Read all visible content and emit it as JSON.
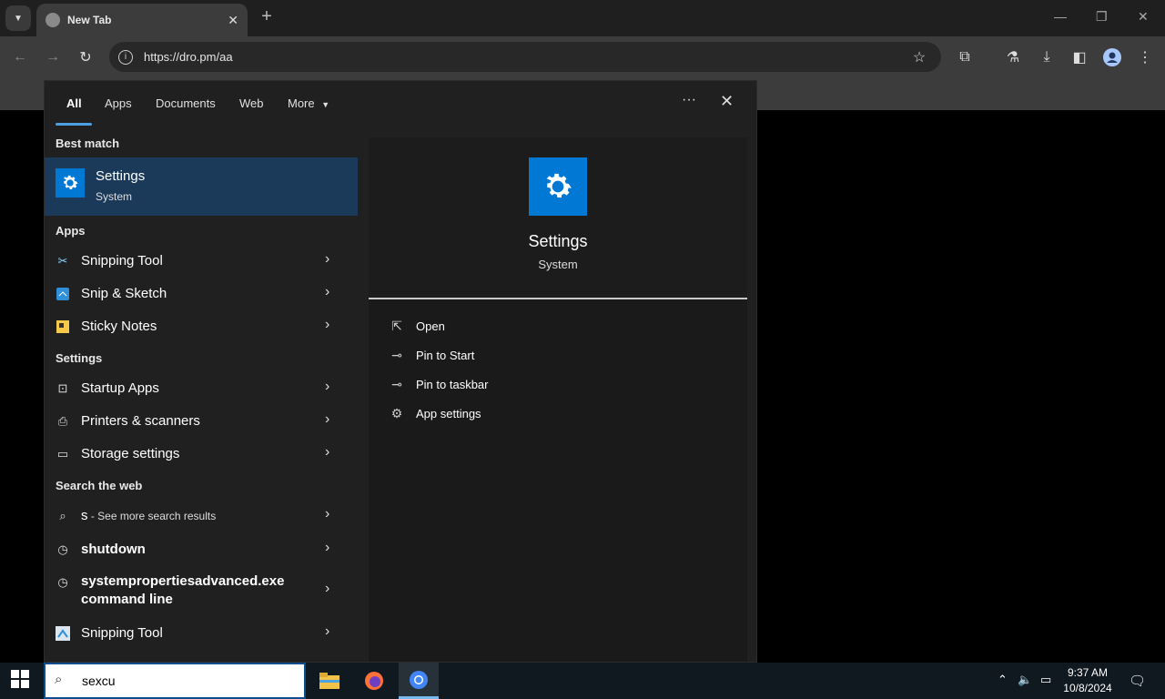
{
  "browser": {
    "tab_title": "New Tab",
    "url": "https://dro.pm/aa"
  },
  "search_panel": {
    "filters": [
      "All",
      "Apps",
      "Documents",
      "Web",
      "More"
    ],
    "more_menu_glyph": "···",
    "best_match_heading": "Best match",
    "best_match": {
      "title": "Settings",
      "subtitle": "System",
      "icon": "gear-icon"
    },
    "apps_heading": "Apps",
    "apps": [
      {
        "label": "Snipping Tool",
        "icon": "snipping-tool-icon"
      },
      {
        "label": "Snip & Sketch",
        "icon": "snip-sketch-icon"
      },
      {
        "label": "Sticky Notes",
        "icon": "sticky-notes-icon"
      }
    ],
    "settings_heading": "Settings",
    "settings": [
      {
        "label": "Startup Apps",
        "icon": "startup-apps-icon"
      },
      {
        "label": "Printers & scanners",
        "icon": "printer-icon"
      },
      {
        "label": "Storage settings",
        "icon": "storage-icon"
      }
    ],
    "web_heading": "Search the web",
    "web": [
      {
        "label": "s",
        "suffix": " - See more search results",
        "icon": "search-icon"
      },
      {
        "label": "shutdown",
        "icon": "history-icon"
      },
      {
        "label": "systempropertiesadvanced.exe",
        "label2": "command line",
        "icon": "history-icon"
      },
      {
        "label": "Snipping Tool",
        "icon": "snipping-tool-icon"
      }
    ],
    "detail": {
      "title": "Settings",
      "subtitle": "System",
      "actions": [
        {
          "label": "Open",
          "icon": "open-icon"
        },
        {
          "label": "Pin to Start",
          "icon": "pin-icon"
        },
        {
          "label": "Pin to taskbar",
          "icon": "pin-icon"
        },
        {
          "label": "App settings",
          "icon": "gear-icon"
        }
      ]
    }
  },
  "taskbar": {
    "search_value": "sexcu",
    "time": "9:37 AM",
    "date": "10/8/2024"
  },
  "colors": {
    "accent": "#0078d4",
    "selection": "#1b3a5a",
    "taskbar": "#101820"
  }
}
